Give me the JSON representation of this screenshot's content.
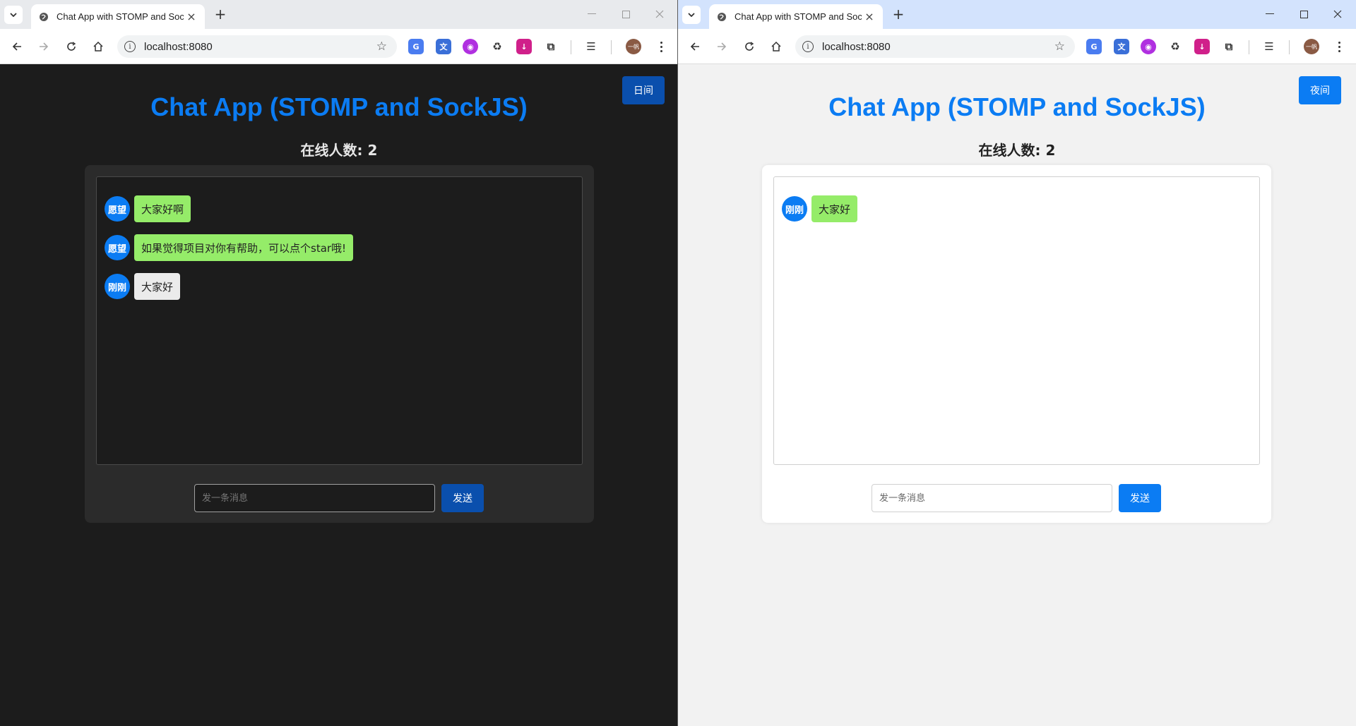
{
  "browser": {
    "tab_title": "Chat App with STOMP and SockJS",
    "url": "localhost:8080",
    "profile_label": "一帆"
  },
  "left": {
    "theme_toggle_label": "日间",
    "title": "Chat App (STOMP and SockJS)",
    "online_count": "在线人数: 2",
    "messages": [
      {
        "avatar": "愿望",
        "text": "大家好啊",
        "style": "green"
      },
      {
        "avatar": "愿望",
        "text": "如果觉得项目对你有帮助，可以点个star哦!",
        "style": "green"
      },
      {
        "avatar": "刚刚",
        "text": "大家好",
        "style": "grey"
      }
    ],
    "input_placeholder": "发一条消息",
    "send_label": "发送"
  },
  "right": {
    "theme_toggle_label": "夜间",
    "title": "Chat App (STOMP and SockJS)",
    "online_count": "在线人数: 2",
    "messages": [
      {
        "avatar": "刚刚",
        "text": "大家好",
        "style": "green"
      }
    ],
    "input_placeholder": "发一条消息",
    "send_label": "发送"
  },
  "colors": {
    "accent": "#0b7cf3",
    "dark_bg": "#1c1c1c",
    "light_bg": "#f2f2f2",
    "bubble_green": "#95ec69",
    "bubble_grey": "#ebebeb"
  }
}
